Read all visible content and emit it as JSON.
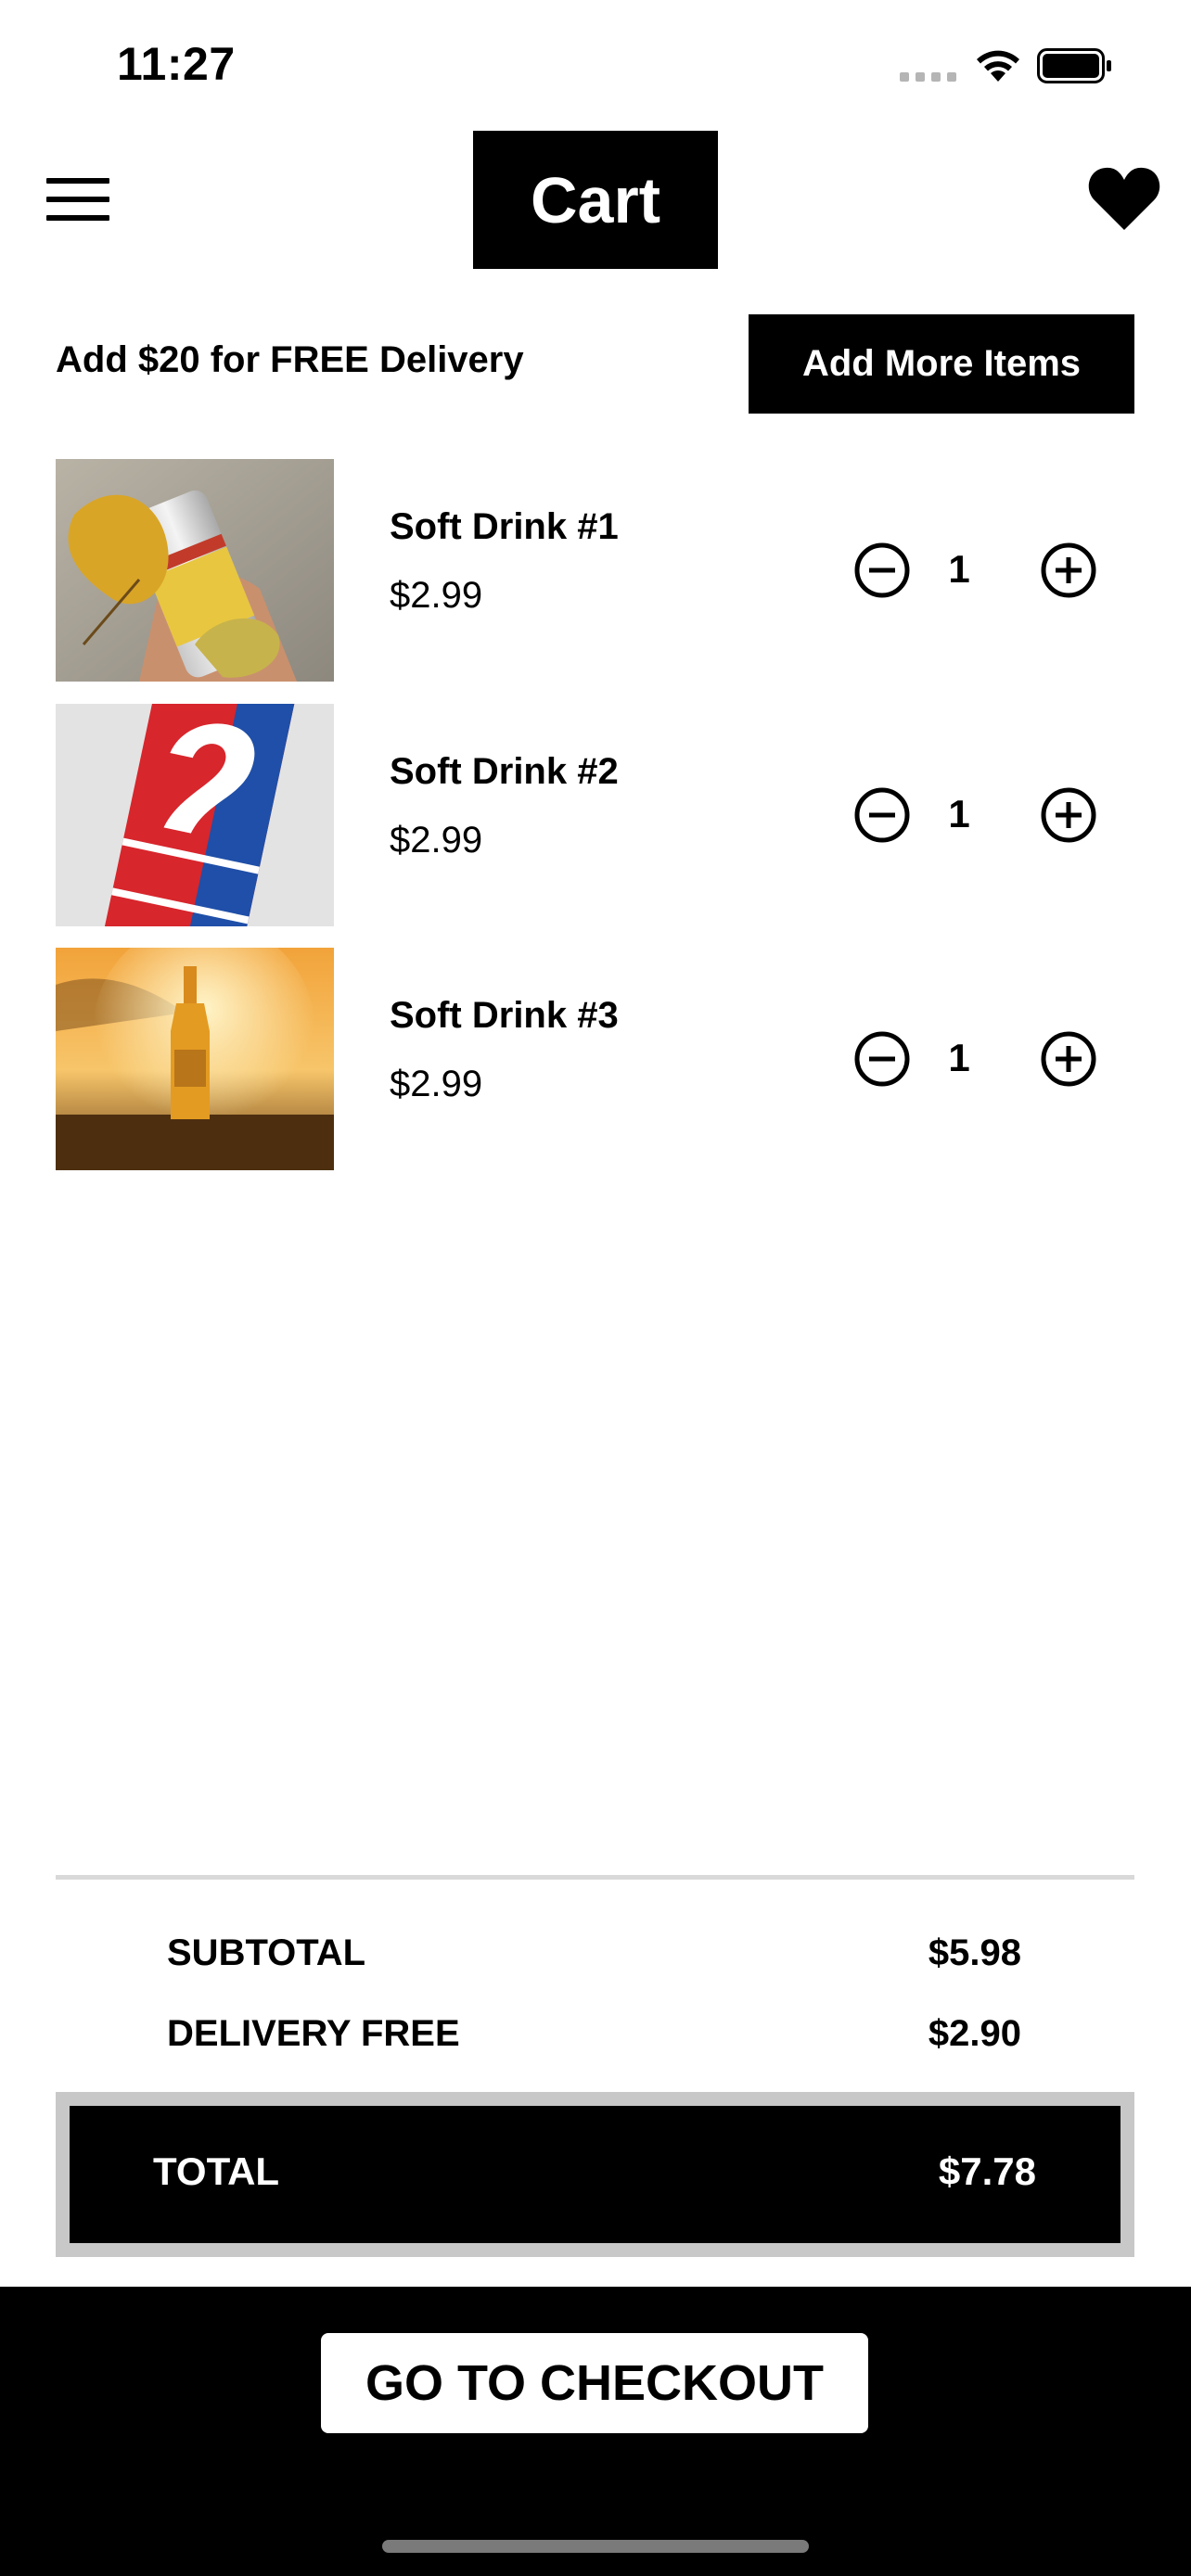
{
  "status_bar": {
    "time": "11:27"
  },
  "header": {
    "title": "Cart",
    "menu_icon": "hamburger-menu-icon",
    "favorite_icon": "heart-icon"
  },
  "promo": {
    "text": "Add $20 for FREE Delivery",
    "button_label": "Add More Items"
  },
  "items": [
    {
      "name": "Soft Drink #1",
      "price": "$2.99",
      "quantity": "1"
    },
    {
      "name": "Soft Drink #2",
      "price": "$2.99",
      "quantity": "1"
    },
    {
      "name": "Soft Drink #3",
      "price": "$2.99",
      "quantity": "1"
    }
  ],
  "summary": {
    "subtotal_label": "SUBTOTAL",
    "subtotal_value": "$5.98",
    "delivery_label": "DELIVERY FREE",
    "delivery_value": "$2.90",
    "total_label": "TOTAL",
    "total_value": "$7.78"
  },
  "checkout": {
    "button_label": "GO TO CHECKOUT"
  },
  "colors": {
    "primary": "#000000",
    "background": "#ffffff",
    "divider": "#d9d9d9",
    "total_border": "#c8c8c8"
  }
}
